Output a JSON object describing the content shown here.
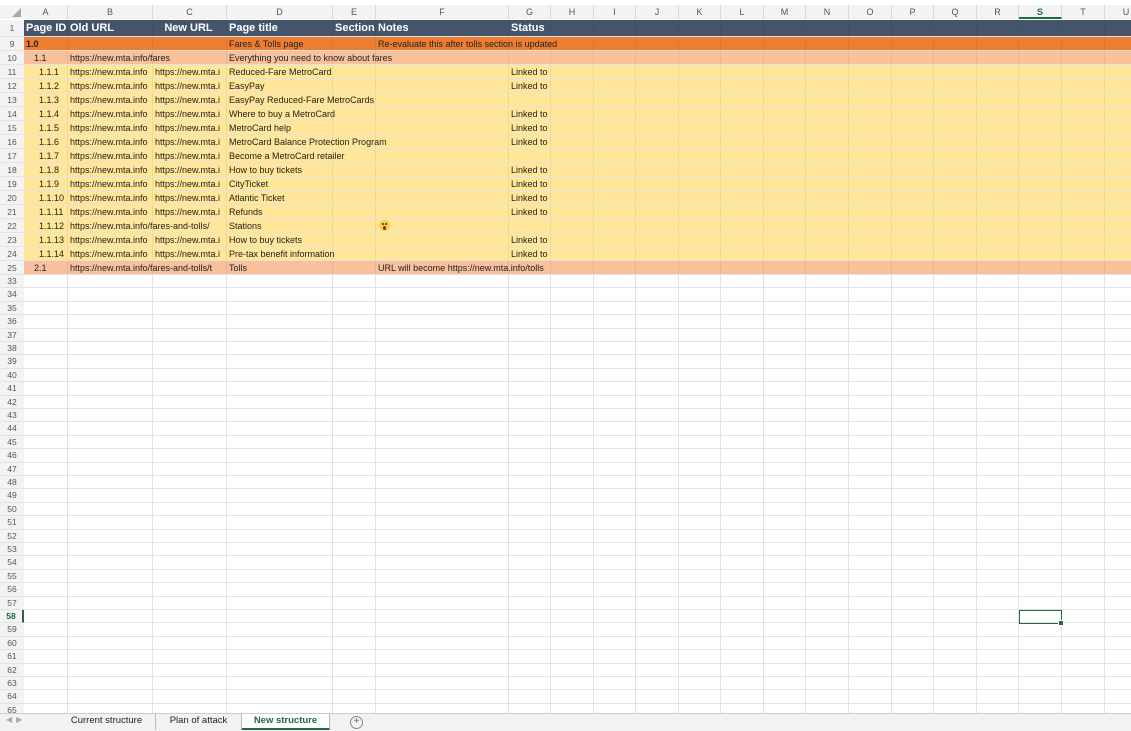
{
  "colors": {
    "header_bg": "#44546a",
    "row_orange": "#ed7d31",
    "row_salmon": "#f8c19b",
    "row_yellow": "#ffe699",
    "accent": "#1e6b3a"
  },
  "column_letters": [
    "A",
    "B",
    "C",
    "D",
    "E",
    "F",
    "G",
    "H",
    "I",
    "J",
    "K",
    "L",
    "M",
    "N",
    "O",
    "P",
    "Q",
    "R",
    "S",
    "T",
    "U"
  ],
  "selected_column": "S",
  "selected_row": "58",
  "header_row": {
    "row_number": "1",
    "page_id": "Page ID",
    "old_url": "Old URL",
    "new_url": "New URL",
    "page_title": "Page title",
    "section": "Section",
    "notes": "Notes",
    "status": "Status"
  },
  "rows": [
    {
      "num": "9",
      "style": "orange",
      "a": "1.0",
      "b": "",
      "c": "",
      "d": "Fares & Tolls page",
      "e": "",
      "f": "Re-evaluate this after tolls section is updated",
      "g": ""
    },
    {
      "num": "10",
      "style": "salmon",
      "a": "1.1",
      "b": "https://new.mta.info/fares",
      "c": "",
      "d": "Everything you need to know about fares",
      "e": "",
      "f": "",
      "g": ""
    },
    {
      "num": "11",
      "style": "yellow",
      "a": "1.1.1",
      "b": "https://new.mta.info",
      "c": "https://new.mta.i",
      "d": "Reduced-Fare MetroCard",
      "e": "",
      "f": "",
      "g": "Linked to"
    },
    {
      "num": "12",
      "style": "yellow",
      "a": "1.1.2",
      "b": "https://new.mta.info",
      "c": "https://new.mta.i",
      "d": "EasyPay",
      "e": "",
      "f": "",
      "g": "Linked to"
    },
    {
      "num": "13",
      "style": "yellow",
      "a": "1.1.3",
      "b": "https://new.mta.info",
      "c": "https://new.mta.i",
      "d": "EasyPay Reduced-Fare MetroCards",
      "e": "",
      "f": "",
      "g": ""
    },
    {
      "num": "14",
      "style": "yellow",
      "a": "1.1.4",
      "b": "https://new.mta.info",
      "c": "https://new.mta.i",
      "d": "Where to buy a MetroCard",
      "e": "",
      "f": "",
      "g": "Linked to"
    },
    {
      "num": "15",
      "style": "yellow",
      "a": "1.1.5",
      "b": "https://new.mta.info",
      "c": "https://new.mta.i",
      "d": "MetroCard help",
      "e": "",
      "f": "",
      "g": "Linked to"
    },
    {
      "num": "16",
      "style": "yellow",
      "a": "1.1.6",
      "b": "https://new.mta.info",
      "c": "https://new.mta.i",
      "d": "MetroCard Balance Protection Program",
      "e": "",
      "f": "",
      "g": "Linked to"
    },
    {
      "num": "17",
      "style": "yellow",
      "a": "1.1.7",
      "b": "https://new.mta.info",
      "c": "https://new.mta.i",
      "d": "Become a MetroCard retailer",
      "e": "",
      "f": "",
      "g": ""
    },
    {
      "num": "18",
      "style": "yellow",
      "a": "1.1.8",
      "b": "https://new.mta.info",
      "c": "https://new.mta.i",
      "d": "How to buy tickets",
      "e": "",
      "f": "",
      "g": "Linked to"
    },
    {
      "num": "19",
      "style": "yellow",
      "a": "1.1.9",
      "b": "https://new.mta.info",
      "c": "https://new.mta.i",
      "d": "CityTicket",
      "e": "",
      "f": "",
      "g": "Linked to"
    },
    {
      "num": "20",
      "style": "yellow",
      "a": "1.1.10",
      "b": "https://new.mta.info",
      "c": "https://new.mta.i",
      "d": "Atlantic Ticket",
      "e": "",
      "f": "",
      "g": "Linked to"
    },
    {
      "num": "21",
      "style": "yellow",
      "a": "1.1.11",
      "b": "https://new.mta.info",
      "c": "https://new.mta.i",
      "d": "Refunds",
      "e": "",
      "f": "",
      "g": "Linked to"
    },
    {
      "num": "22",
      "style": "yellow",
      "a": "1.1.12",
      "b": "https://new.mta.info/fares-and-tolls/",
      "c": "",
      "d": "Stations",
      "e": "",
      "f": "scream-emoji",
      "g": ""
    },
    {
      "num": "23",
      "style": "yellow",
      "a": "1.1.13",
      "b": "https://new.mta.info",
      "c": "https://new.mta.i",
      "d": "How to buy tickets",
      "e": "",
      "f": "",
      "g": "Linked to"
    },
    {
      "num": "24",
      "style": "yellow",
      "a": "1.1.14",
      "b": "https://new.mta.info",
      "c": "https://new.mta.i",
      "d": "Pre-tax benefit information",
      "e": "",
      "f": "",
      "g": "Linked to"
    },
    {
      "num": "25",
      "style": "salmon",
      "a": "2.1",
      "b": "https://new.mta.info/fares-and-tolls/t",
      "c": "",
      "d": "Tolls",
      "e": "",
      "f": "URL will become https://new.mta.info/tolls",
      "g": ""
    }
  ],
  "empty_rows": [
    "33",
    "34",
    "35",
    "36",
    "37",
    "38",
    "39",
    "40",
    "41",
    "42",
    "43",
    "44",
    "45",
    "46",
    "47",
    "48",
    "49",
    "50",
    "51",
    "52",
    "53",
    "54",
    "55",
    "56",
    "57",
    "58",
    "59",
    "60",
    "61",
    "62",
    "63",
    "64",
    "65"
  ],
  "sheet_tabs": [
    {
      "label": "Current structure",
      "active": false
    },
    {
      "label": "Plan of attack",
      "active": false
    },
    {
      "label": "New structure",
      "active": true
    }
  ],
  "add_sheet_label": "+"
}
